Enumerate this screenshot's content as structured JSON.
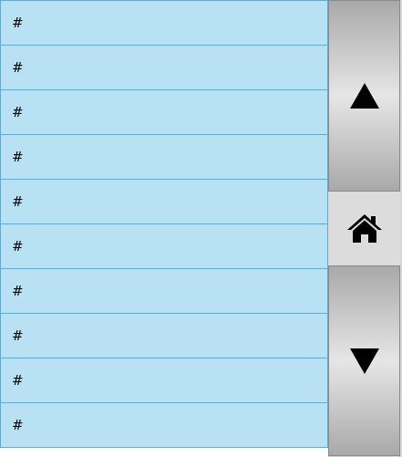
{
  "list": {
    "items": [
      {
        "label": "#"
      },
      {
        "label": "#"
      },
      {
        "label": "#"
      },
      {
        "label": "#"
      },
      {
        "label": "#"
      },
      {
        "label": "#"
      },
      {
        "label": "#"
      },
      {
        "label": "#"
      },
      {
        "label": "#"
      },
      {
        "label": "#"
      }
    ]
  },
  "controls": {
    "scroll_up_icon": "triangle-up-icon",
    "home_icon": "home-icon",
    "scroll_down_icon": "triangle-down-icon"
  },
  "colors": {
    "row_background": "#b8e1f3",
    "row_border": "#4fb1e3",
    "button_gradient_edge": "#a9a9a9",
    "button_gradient_center": "#e6e6e6"
  }
}
